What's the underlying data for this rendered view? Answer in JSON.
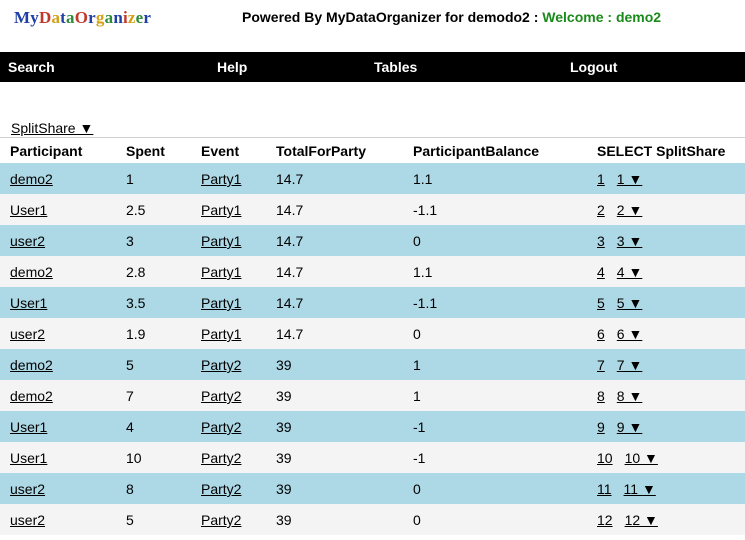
{
  "logo": {
    "letters": [
      {
        "ch": "M",
        "color": "#1f3fa6"
      },
      {
        "ch": "y",
        "color": "#1f3fa6"
      },
      {
        "ch": "D",
        "color": "#c0392b"
      },
      {
        "ch": "a",
        "color": "#d4a017"
      },
      {
        "ch": "t",
        "color": "#1f3fa6"
      },
      {
        "ch": "a",
        "color": "#2e8b3c"
      },
      {
        "ch": "O",
        "color": "#c0392b"
      },
      {
        "ch": "r",
        "color": "#1f3fa6"
      },
      {
        "ch": "g",
        "color": "#d4a017"
      },
      {
        "ch": "a",
        "color": "#2e8b3c"
      },
      {
        "ch": "n",
        "color": "#1f3fa6"
      },
      {
        "ch": "i",
        "color": "#c0392b"
      },
      {
        "ch": "z",
        "color": "#d4a017"
      },
      {
        "ch": "e",
        "color": "#2e8b3c"
      },
      {
        "ch": "r",
        "color": "#1f3fa6"
      }
    ]
  },
  "header": {
    "powered": "Powered By MyDataOrganizer for demodo2 : ",
    "welcome": "Welcome : demo2"
  },
  "nav": {
    "search": "Search",
    "help": "Help",
    "tables": "Tables",
    "logout": "Logout"
  },
  "table_selector": "SplitShare ▼",
  "columns": [
    "Participant",
    "Spent",
    "Event",
    "TotalForParty",
    "ParticipantBalance",
    "SELECT SplitShare"
  ],
  "rows": [
    {
      "participant": "demo2",
      "spent": "1",
      "event": "Party1",
      "total": "14.7",
      "balance": "1.1",
      "id": "1",
      "sel": "1 ▼"
    },
    {
      "participant": "User1",
      "spent": "2.5",
      "event": "Party1",
      "total": "14.7",
      "balance": "-1.1",
      "id": "2",
      "sel": "2 ▼"
    },
    {
      "participant": "user2",
      "spent": "3",
      "event": "Party1",
      "total": "14.7",
      "balance": "0",
      "id": "3",
      "sel": "3 ▼"
    },
    {
      "participant": "demo2",
      "spent": "2.8",
      "event": "Party1",
      "total": "14.7",
      "balance": "1.1",
      "id": "4",
      "sel": "4 ▼"
    },
    {
      "participant": "User1",
      "spent": "3.5",
      "event": "Party1",
      "total": "14.7",
      "balance": "-1.1",
      "id": "5",
      "sel": "5 ▼"
    },
    {
      "participant": "user2",
      "spent": "1.9",
      "event": "Party1",
      "total": "14.7",
      "balance": "0",
      "id": "6",
      "sel": "6 ▼"
    },
    {
      "participant": "demo2",
      "spent": "5",
      "event": "Party2",
      "total": "39",
      "balance": "1",
      "id": "7",
      "sel": "7 ▼"
    },
    {
      "participant": "demo2",
      "spent": "7",
      "event": "Party2",
      "total": "39",
      "balance": "1",
      "id": "8",
      "sel": "8 ▼"
    },
    {
      "participant": "User1",
      "spent": "4",
      "event": "Party2",
      "total": "39",
      "balance": "-1",
      "id": "9",
      "sel": "9 ▼"
    },
    {
      "participant": "User1",
      "spent": "10",
      "event": "Party2",
      "total": "39",
      "balance": "-1",
      "id": "10",
      "sel": "10 ▼"
    },
    {
      "participant": "user2",
      "spent": "8",
      "event": "Party2",
      "total": "39",
      "balance": "0",
      "id": "11",
      "sel": "11 ▼"
    },
    {
      "participant": "user2",
      "spent": "5",
      "event": "Party2",
      "total": "39",
      "balance": "0",
      "id": "12",
      "sel": "12 ▼"
    }
  ]
}
